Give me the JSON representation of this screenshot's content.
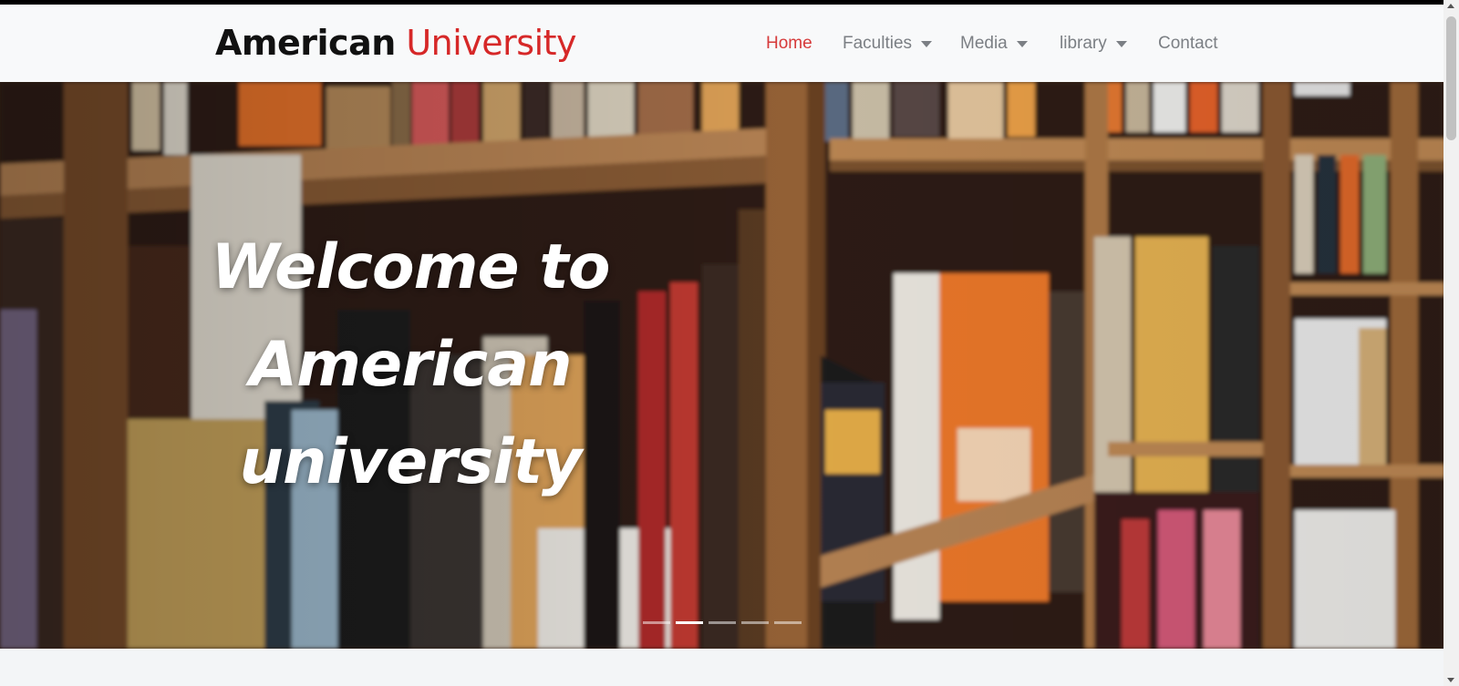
{
  "brand": {
    "part1": "American",
    "part2": "University"
  },
  "nav": {
    "items": [
      {
        "label": "Home",
        "active": true,
        "dropdown": false
      },
      {
        "label": "Faculties",
        "active": false,
        "dropdown": true
      },
      {
        "label": "Media",
        "active": false,
        "dropdown": true
      },
      {
        "label": "library",
        "active": false,
        "dropdown": true
      },
      {
        "label": "Contact",
        "active": false,
        "dropdown": false
      }
    ]
  },
  "hero": {
    "title_lines": [
      "Welcome to",
      "American",
      "university"
    ],
    "slide_count": 5,
    "active_slide": 2
  },
  "colors": {
    "accent": "#d62828",
    "nav_text": "#7b7f84",
    "navbar_bg": "#f8f9fa"
  }
}
